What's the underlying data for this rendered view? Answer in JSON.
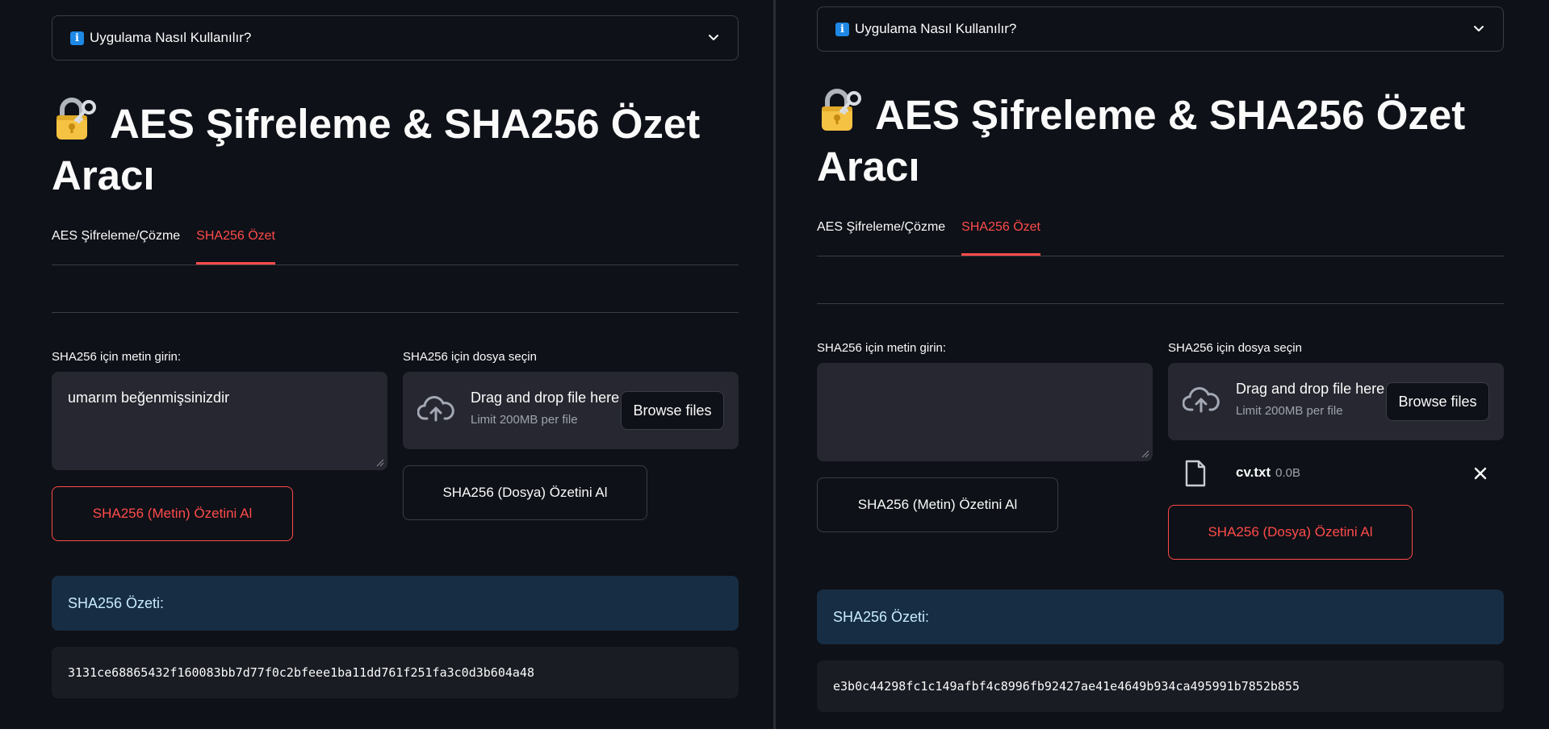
{
  "left": {
    "expander_label": "Uygulama Nasıl Kullanılır?",
    "title": "AES Şifreleme & SHA256 Özet Aracı",
    "tabs": [
      {
        "label": "AES Şifreleme/Çözme"
      },
      {
        "label": "SHA256 Özet"
      }
    ],
    "active_tab": 1,
    "text_label": "SHA256 için metin girin:",
    "text_value": "umarım beğenmişsinizdir",
    "file_label": "SHA256 için dosya seçin",
    "dropzone_main": "Drag and drop file here",
    "dropzone_sub": "Limit 200MB per file",
    "browse_label": "Browse files",
    "btn_text_hash": "SHA256 (Metin) Özetini Al",
    "btn_file_hash": "SHA256 (Dosya) Özetini Al",
    "primary_button": "text",
    "result_label": "SHA256 Özeti:",
    "result_hash": "3131ce68865432f160083bb7d77f0c2bfeee1ba11dd761f251fa3c0d3b604a48"
  },
  "right": {
    "expander_label": "Uygulama Nasıl Kullanılır?",
    "title": "AES Şifreleme & SHA256 Özet Aracı",
    "tabs": [
      {
        "label": "AES Şifreleme/Çözme"
      },
      {
        "label": "SHA256 Özet"
      }
    ],
    "active_tab": 1,
    "text_label": "SHA256 için metin girin:",
    "text_value": "",
    "file_label": "SHA256 için dosya seçin",
    "dropzone_main": "Drag and drop file here",
    "dropzone_sub": "Limit 200MB per file",
    "browse_label": "Browse files",
    "uploaded_file": {
      "name": "cv.txt",
      "size": "0.0B"
    },
    "btn_text_hash": "SHA256 (Metin) Özetini Al",
    "btn_file_hash": "SHA256 (Dosya) Özetini Al",
    "primary_button": "file",
    "result_label": "SHA256 Özeti:",
    "result_hash": "e3b0c44298fc1c149afbf4c8996fb92427ae41e4649b934ca495991b7852b855"
  },
  "colors": {
    "background": "#0e1117",
    "accent": "#ff4b4b",
    "input_bg": "#262730",
    "info_bg": "#172d43",
    "info_text": "#c7ebff"
  },
  "icons": {
    "info": "information-icon",
    "lock": "lock-with-key-emoji",
    "chevron": "chevron-down-icon",
    "upload": "cloud-upload-icon",
    "file": "file-icon",
    "close": "close-icon"
  }
}
